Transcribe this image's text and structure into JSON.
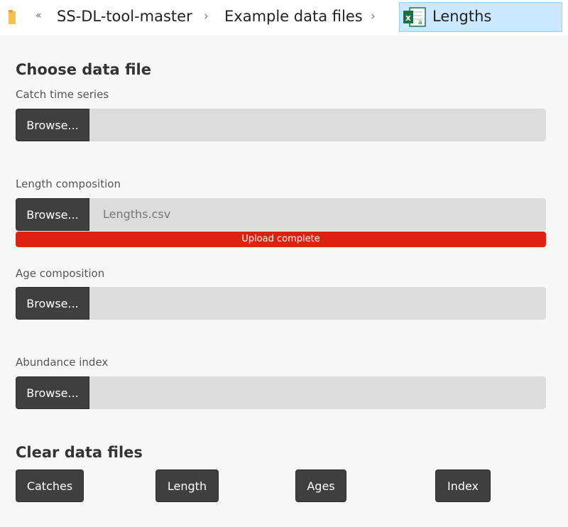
{
  "breadcrumb": {
    "overflow_glyph": "«",
    "items": [
      "SS-DL-tool-master",
      "Example data files"
    ],
    "separator": "›",
    "current": "Lengths"
  },
  "choose_heading": "Choose data file",
  "browse_label": "Browse...",
  "fields": [
    {
      "label": "Catch time series",
      "file": ""
    },
    {
      "label": "Length composition",
      "file": "Lengths.csv",
      "status": "Upload complete"
    },
    {
      "label": "Age composition",
      "file": ""
    },
    {
      "label": "Abundance index",
      "file": ""
    }
  ],
  "clear_heading": "Clear data files",
  "clear_buttons": [
    "Catches",
    "Length",
    "Ages",
    "Index"
  ],
  "colors": {
    "progress": "#dd2211",
    "button": "#3f3f3f",
    "selected_crumb": "#cce8ff"
  },
  "icons": {
    "folder": "folder-icon",
    "file": "excel-icon"
  }
}
